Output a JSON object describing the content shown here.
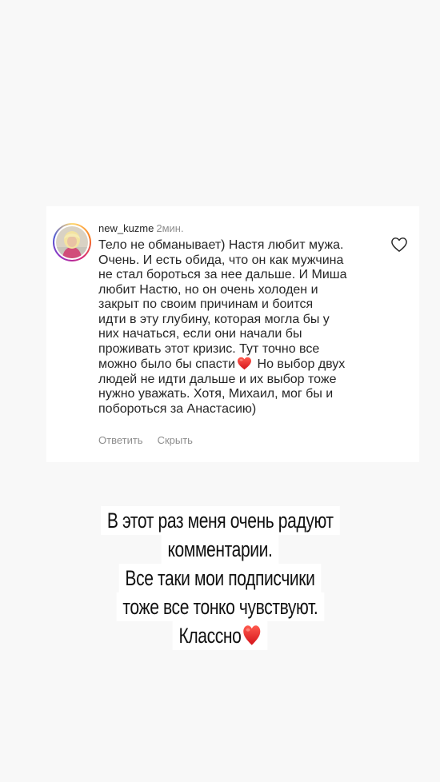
{
  "comment": {
    "username": "new_kuzme",
    "time": "2мин.",
    "text_before_heart": "Тело не обманывает) Настя любит мужа.\nОчень. И есть обида, что он как мужчина\nне стал бороться за нее дальше. И Миша\nлюбит Настю, но он очень холоден и\nзакрыт по своим причинам и боится\nидти в эту глубину, которая могла бы у\nних начаться, если они начали бы\nпроживать этот кризис. Тут точно все\nможно было бы спасти",
    "text_after_heart": " Но выбор двух\nлюдей не идти дальше и их выбор тоже\nнужно уважать. Хотя, Михаил, мог бы и\nпобороться за Анастасию)",
    "reply_label": "Ответить",
    "hide_label": "Скрыть",
    "heart_emoji_icon": "red-heart-emoji-icon",
    "like_icon": "heart-outline-icon"
  },
  "story": {
    "caption_lines": [
      "В этот раз меня очень радуют",
      "комментарии.",
      "Все таки мои подписчики",
      "тоже все тонко чувствуют.",
      "Классно"
    ],
    "caption_heart_icon": "red-heart-emoji-icon"
  },
  "colors": {
    "background": "#f8f8f8",
    "card": "#ffffff",
    "text": "#262626",
    "muted": "#8e8e8e",
    "heart": "#e0201d"
  }
}
